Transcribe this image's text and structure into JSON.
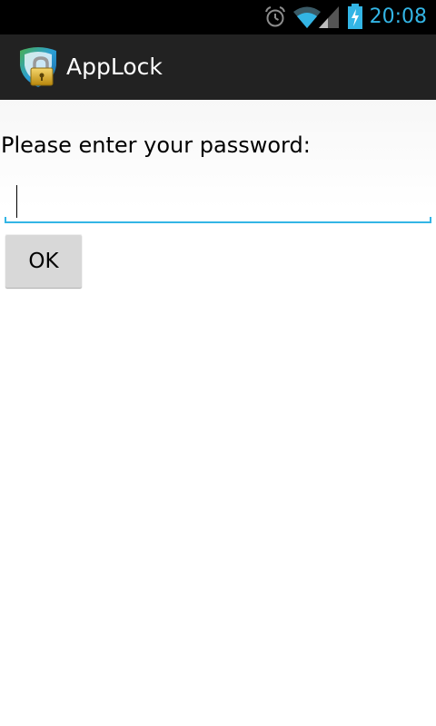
{
  "status_bar": {
    "time": "20:08",
    "icons": [
      "alarm-icon",
      "wifi-icon",
      "signal-icon",
      "battery-charging-icon"
    ],
    "accent_color": "#33b5e5"
  },
  "action_bar": {
    "title": "AppLock",
    "icon": "applock-shield-icon",
    "background": "#222222"
  },
  "form": {
    "prompt": "Please enter your password:",
    "password_value": "",
    "ok_label": "OK"
  }
}
